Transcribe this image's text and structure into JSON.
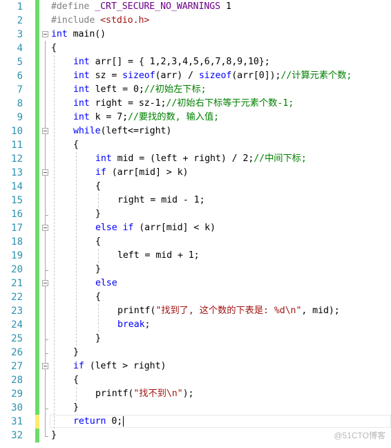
{
  "editor": {
    "language": "C",
    "cursor_line": 31,
    "colors": {
      "line_number": "#2b91af",
      "saved_change": "#6bdb6b",
      "unsaved_change": "#fdeb6e",
      "keyword": "#0000ff",
      "macro": "#6f008a",
      "string": "#a31515",
      "comment": "#008000",
      "preprocessor": "#808080"
    },
    "lines": [
      {
        "n": "1",
        "status": "saved",
        "fold": false,
        "indent": 0,
        "tokens": [
          [
            "pp",
            "#define "
          ],
          [
            "mac",
            "_CRT_SECURE_NO_WARNINGS"
          ],
          [
            "",
            ""
          ],
          [
            "plain",
            " 1"
          ]
        ]
      },
      {
        "n": "2",
        "status": "saved",
        "fold": false,
        "indent": 0,
        "tokens": [
          [
            "pp",
            "#include "
          ],
          [
            "inc",
            "<stdio.h>"
          ]
        ]
      },
      {
        "n": "3",
        "status": "saved",
        "fold": true,
        "indent": 0,
        "tokens": [
          [
            "kw",
            "int"
          ],
          [
            "plain",
            " main()"
          ]
        ]
      },
      {
        "n": "4",
        "status": "saved",
        "fold": false,
        "indent": 0,
        "tokens": [
          [
            "plain",
            "{"
          ]
        ]
      },
      {
        "n": "5",
        "status": "saved",
        "fold": false,
        "indent": 1,
        "tokens": [
          [
            "kw",
            "int"
          ],
          [
            "plain",
            " arr[] = { 1,2,3,4,5,6,7,8,9,10};"
          ]
        ]
      },
      {
        "n": "6",
        "status": "saved",
        "fold": false,
        "indent": 1,
        "tokens": [
          [
            "kw",
            "int"
          ],
          [
            "plain",
            " sz = "
          ],
          [
            "kw",
            "sizeof"
          ],
          [
            "plain",
            "(arr) / "
          ],
          [
            "kw",
            "sizeof"
          ],
          [
            "plain",
            "(arr[0]);"
          ],
          [
            "cm",
            "//计算元素个数;"
          ]
        ]
      },
      {
        "n": "7",
        "status": "saved",
        "fold": false,
        "indent": 1,
        "tokens": [
          [
            "kw",
            "int"
          ],
          [
            "plain",
            " left = 0;"
          ],
          [
            "cm",
            "//初始左下标;"
          ]
        ]
      },
      {
        "n": "8",
        "status": "saved",
        "fold": false,
        "indent": 1,
        "tokens": [
          [
            "kw",
            "int"
          ],
          [
            "plain",
            " right = sz-1;"
          ],
          [
            "cm",
            "//初始右下标等于元素个数-1;"
          ]
        ]
      },
      {
        "n": "9",
        "status": "saved",
        "fold": false,
        "indent": 1,
        "tokens": [
          [
            "kw",
            "int"
          ],
          [
            "plain",
            " k = 7;"
          ],
          [
            "cm",
            "//要找的数, 输入值;"
          ]
        ]
      },
      {
        "n": "10",
        "status": "saved",
        "fold": true,
        "indent": 1,
        "tokens": [
          [
            "kw",
            "while"
          ],
          [
            "plain",
            "(left<=right)"
          ]
        ]
      },
      {
        "n": "11",
        "status": "saved",
        "fold": false,
        "indent": 1,
        "tokens": [
          [
            "plain",
            "{"
          ]
        ]
      },
      {
        "n": "12",
        "status": "saved",
        "fold": false,
        "indent": 2,
        "tokens": [
          [
            "kw",
            "int"
          ],
          [
            "plain",
            " mid = (left + right) / 2;"
          ],
          [
            "cm",
            "//中间下标;"
          ]
        ]
      },
      {
        "n": "13",
        "status": "saved",
        "fold": true,
        "indent": 2,
        "tokens": [
          [
            "kw",
            "if"
          ],
          [
            "plain",
            " (arr[mid] > k)"
          ]
        ]
      },
      {
        "n": "14",
        "status": "saved",
        "fold": false,
        "indent": 2,
        "tokens": [
          [
            "plain",
            "{"
          ]
        ]
      },
      {
        "n": "15",
        "status": "saved",
        "fold": false,
        "indent": 3,
        "tokens": [
          [
            "plain",
            "right = mid - 1;"
          ]
        ]
      },
      {
        "n": "16",
        "status": "saved",
        "fold": false,
        "indent": 2,
        "tokens": [
          [
            "plain",
            "}"
          ]
        ]
      },
      {
        "n": "17",
        "status": "saved",
        "fold": true,
        "indent": 2,
        "tokens": [
          [
            "kw",
            "else if"
          ],
          [
            "plain",
            " (arr[mid] < k)"
          ]
        ]
      },
      {
        "n": "18",
        "status": "saved",
        "fold": false,
        "indent": 2,
        "tokens": [
          [
            "plain",
            "{"
          ]
        ]
      },
      {
        "n": "19",
        "status": "saved",
        "fold": false,
        "indent": 3,
        "tokens": [
          [
            "plain",
            "left = mid + 1;"
          ]
        ]
      },
      {
        "n": "20",
        "status": "saved",
        "fold": false,
        "indent": 2,
        "tokens": [
          [
            "plain",
            "}"
          ]
        ]
      },
      {
        "n": "21",
        "status": "saved",
        "fold": true,
        "indent": 2,
        "tokens": [
          [
            "kw",
            "else"
          ]
        ]
      },
      {
        "n": "22",
        "status": "saved",
        "fold": false,
        "indent": 2,
        "tokens": [
          [
            "plain",
            "{"
          ]
        ]
      },
      {
        "n": "23",
        "status": "saved",
        "fold": false,
        "indent": 3,
        "tokens": [
          [
            "plain",
            "printf("
          ],
          [
            "str",
            "\"找到了, 这个数的下表是: %d\\n\""
          ],
          [
            "plain",
            ", mid);"
          ]
        ]
      },
      {
        "n": "24",
        "status": "saved",
        "fold": false,
        "indent": 3,
        "tokens": [
          [
            "kw",
            "break"
          ],
          [
            "plain",
            ";"
          ]
        ]
      },
      {
        "n": "25",
        "status": "saved",
        "fold": false,
        "indent": 2,
        "tokens": [
          [
            "plain",
            "}"
          ]
        ]
      },
      {
        "n": "26",
        "status": "saved",
        "fold": false,
        "indent": 1,
        "tokens": [
          [
            "plain",
            "}"
          ]
        ]
      },
      {
        "n": "27",
        "status": "saved",
        "fold": true,
        "indent": 1,
        "tokens": [
          [
            "kw",
            "if"
          ],
          [
            "plain",
            " (left > right)"
          ]
        ]
      },
      {
        "n": "28",
        "status": "saved",
        "fold": false,
        "indent": 1,
        "tokens": [
          [
            "plain",
            "{"
          ]
        ]
      },
      {
        "n": "29",
        "status": "saved",
        "fold": false,
        "indent": 2,
        "tokens": [
          [
            "plain",
            "printf("
          ],
          [
            "str",
            "\"找不到\\n\""
          ],
          [
            "plain",
            ");"
          ]
        ]
      },
      {
        "n": "30",
        "status": "saved",
        "fold": false,
        "indent": 1,
        "tokens": [
          [
            "plain",
            "}"
          ]
        ]
      },
      {
        "n": "31",
        "status": "unsaved",
        "fold": false,
        "indent": 1,
        "tokens": [
          [
            "kw",
            "return"
          ],
          [
            "plain",
            " 0;"
          ]
        ]
      },
      {
        "n": "32",
        "status": "saved",
        "fold": false,
        "indent": 0,
        "tokens": [
          [
            "plain",
            "}"
          ]
        ]
      }
    ]
  },
  "watermark": "@51CTO博客"
}
